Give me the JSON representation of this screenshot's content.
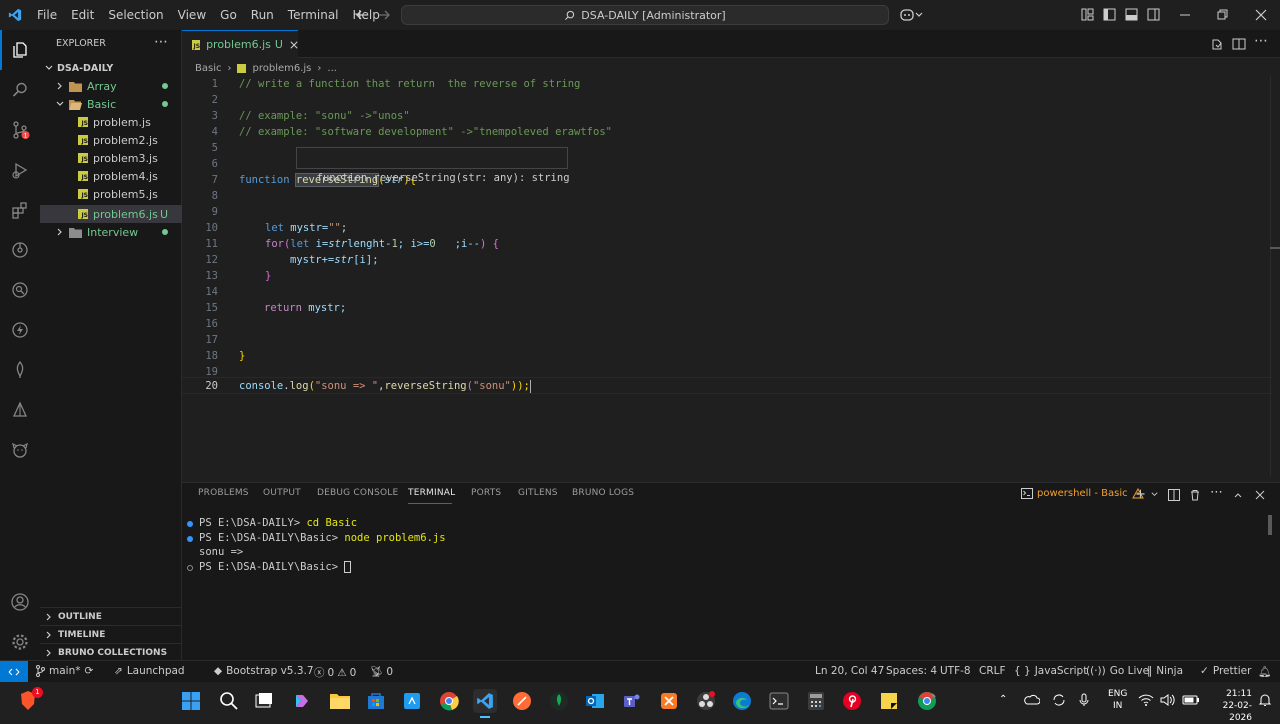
{
  "menu": [
    "File",
    "Edit",
    "Selection",
    "View",
    "Go",
    "Run",
    "Terminal",
    "Help"
  ],
  "window_title": "DSA-DAILY [Administrator]",
  "explorer": {
    "title": "EXPLORER",
    "root": "DSA-DAILY",
    "items": [
      {
        "label": "Array",
        "type": "folder"
      },
      {
        "label": "Basic",
        "type": "folder-open"
      },
      {
        "label": "problem.js",
        "type": "file"
      },
      {
        "label": "problem2.js",
        "type": "file"
      },
      {
        "label": "problem3.js",
        "type": "file"
      },
      {
        "label": "problem4.js",
        "type": "file"
      },
      {
        "label": "problem5.js",
        "type": "file"
      },
      {
        "label": "problem6.js",
        "type": "file",
        "badge": "U"
      },
      {
        "label": "Interview",
        "type": "folder"
      }
    ],
    "sections": [
      "OUTLINE",
      "TIMELINE",
      "BRUNO COLLECTIONS"
    ]
  },
  "tab": {
    "label": "problem6.js",
    "badge": "U"
  },
  "breadcrumb": {
    "folder": "Basic",
    "file": "problem6.js",
    "more": "..."
  },
  "hover": "function reverseString(str: any): string",
  "code": {
    "line_numbers": [
      "1",
      "2",
      "3",
      "4",
      "5",
      "6",
      "7",
      "8",
      "9",
      "10",
      "11",
      "12",
      "13",
      "14",
      "15",
      "16",
      "17",
      "18",
      "19",
      "20"
    ],
    "l1": "// write a function that return  the reverse of string",
    "l3": "// example: \"sonu\" ->\"unos\"",
    "l4": "// example: \"software development\" ->\"tnempoleved erawtfos\"",
    "l7": {
      "kw": "function",
      "name": "reverseString",
      "p1": "(",
      "param": "str",
      "p2": "){"
    },
    "l10": {
      "kw": "let",
      "rest": " mystr=",
      "str": "\"\"",
      "end": ";"
    },
    "l11": {
      "kw": "for",
      "b1": "(",
      "kw2": "let",
      "a": " i=",
      "v": "str",
      ".": ".",
      "b": "lenght-",
      "n1": "1",
      "c": "; i>=",
      "n2": "0",
      "d": "   ;i--",
      ")": ")",
      "e": " {"
    },
    "l12": {
      "a": "mystr+=",
      "v": "str",
      "b": "[i];"
    },
    "l13": "}",
    "l15": {
      "kw": "return",
      "rest": " mystr;"
    },
    "l18": "}",
    "l20": {
      "a": "console",
      "b": ".",
      "c": "log",
      "d": "(",
      "s1": "\"sonu => \"",
      "e": ",",
      "f": "reverseString",
      "g": "(",
      "s2": "\"sonu\"",
      "h": "));"
    }
  },
  "panel": {
    "tabs": [
      "PROBLEMS",
      "OUTPUT",
      "DEBUG CONSOLE",
      "TERMINAL",
      "PORTS",
      "GITLENS",
      "BRUNO LOGS"
    ],
    "active_tab": "TERMINAL",
    "shell": "powershell - Basic",
    "lines": [
      {
        "prompt": "PS E:\\DSA-DAILY>",
        "cmd": " cd Basic"
      },
      {
        "prompt": "PS E:\\DSA-DAILY\\Basic>",
        "cmd": " node problem6.js"
      },
      {
        "prompt": "sonu =>",
        "cmd": ""
      },
      {
        "prompt": "PS E:\\DSA-DAILY\\Basic>",
        "cmd": ""
      }
    ]
  },
  "status": {
    "branch": "main*",
    "launchpad": "Launchpad",
    "bootstrap": "Bootstrap v5.3.7",
    "errors": "0",
    "warnings": "0",
    "ports": "0",
    "position": "Ln 20, Col 47",
    "spaces": "Spaces: 4",
    "encoding": "UTF-8",
    "eol": "CRLF",
    "language": "JavaScript",
    "golive": "Go Live",
    "ninja": "Ninja",
    "prettier": "Prettier"
  },
  "taskbar": {
    "lang1": "ENG",
    "lang2": "IN",
    "time": "21:11",
    "date": "22-02-2026",
    "notify": "1"
  },
  "colors": {
    "accent": "#0078d4",
    "git_added": "#73c991",
    "folder": "#c09553",
    "js": "#cbcb41"
  }
}
